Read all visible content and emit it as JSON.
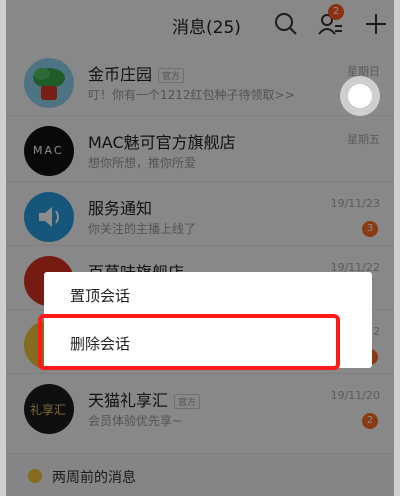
{
  "header": {
    "title": "消息(25)",
    "badge": "2"
  },
  "conversations": [
    {
      "name": "金币庄园",
      "tag": "官方",
      "preview": "叮！你有一个1212红包种子待领取>>",
      "time": "星期日",
      "count": ""
    },
    {
      "name": "MAC魅可官方旗舰店",
      "tag": "",
      "preview": "想你所想，推你所爱",
      "time": "星期五",
      "count": ""
    },
    {
      "name": "服务通知",
      "tag": "",
      "preview": "你关注的主播上线了",
      "time": "19/11/23",
      "count": "3"
    },
    {
      "name": "百草味旗舰店",
      "tag": "",
      "preview": "",
      "time": "19/11/22",
      "count": ""
    },
    {
      "name": "",
      "tag": "",
      "preview": "",
      "time": "22",
      "count": "2"
    },
    {
      "name": "天猫礼享汇",
      "tag": "官方",
      "preview": "会员体验优先享~",
      "time": "19/11/20",
      "count": "2"
    }
  ],
  "section": {
    "label": "两周前的消息"
  },
  "menu": {
    "items": [
      "置顶会话",
      "删除会话"
    ]
  },
  "avatars": {
    "mac_text": "MAC",
    "gift_text": "礼享汇"
  },
  "colors": {
    "accent": "#ff5a1f",
    "highlight": "#ff1a1a"
  }
}
